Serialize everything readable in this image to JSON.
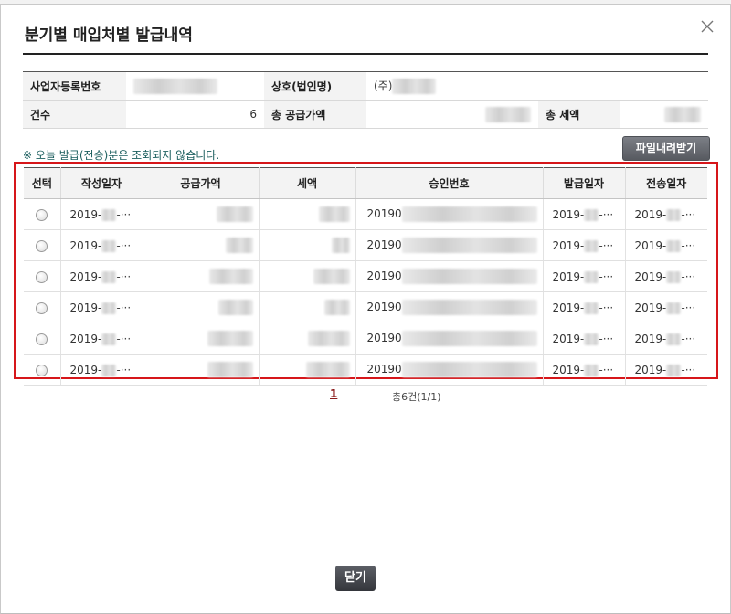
{
  "dialog": {
    "title": "분기별 매입처별 발급내역",
    "close_icon": "close-icon"
  },
  "info": {
    "biz_reg_label": "사업자등록번호",
    "company_label": "상호(법인명)",
    "company_value": "(주)",
    "count_label": "건수",
    "count_value": "6",
    "supply_total_label": "총 공급가액",
    "tax_total_label": "총 세액"
  },
  "notice": "※ 오늘 발급(전송)분은 조회되지 않습니다.",
  "download_button": "파일내려받기",
  "grid": {
    "headers": [
      "선택",
      "작성일자",
      "공급가액",
      "세액",
      "승인번호",
      "발급일자",
      "전송일자"
    ],
    "rows": [
      {
        "write_prefix": "2019-",
        "write_suffix": "-···",
        "approval_prefix": "20190",
        "issue_prefix": "2019-",
        "issue_suffix": "-···",
        "send_prefix": "2019-",
        "send_suffix": "-···"
      },
      {
        "write_prefix": "2019-",
        "write_suffix": "-···",
        "approval_prefix": "20190",
        "issue_prefix": "2019-",
        "issue_suffix": "-···",
        "send_prefix": "2019-",
        "send_suffix": "-···"
      },
      {
        "write_prefix": "2019-",
        "write_suffix": "-···",
        "approval_prefix": "20190",
        "issue_prefix": "2019-",
        "issue_suffix": "-···",
        "send_prefix": "2019-",
        "send_suffix": "-···"
      },
      {
        "write_prefix": "2019-",
        "write_suffix": "-···",
        "approval_prefix": "20190",
        "issue_prefix": "2019-",
        "issue_suffix": "-···",
        "send_prefix": "2019-",
        "send_suffix": "-···"
      },
      {
        "write_prefix": "2019-",
        "write_suffix": "-···",
        "approval_prefix": "20190",
        "issue_prefix": "2019-",
        "issue_suffix": "-···",
        "send_prefix": "2019-",
        "send_suffix": "-···"
      },
      {
        "write_prefix": "2019-",
        "write_suffix": "-···",
        "approval_prefix": "20190",
        "issue_prefix": "2019-",
        "issue_suffix": "-···",
        "send_prefix": "2019-",
        "send_suffix": "-···"
      }
    ]
  },
  "pagination": {
    "current_page": "1",
    "total": "총6건(1/1)"
  },
  "footer": {
    "close_label": "닫기"
  },
  "colors": {
    "highlight_border": "#d6161a",
    "button_dark": "#34363b",
    "notice_text": "#1b5e5e"
  }
}
